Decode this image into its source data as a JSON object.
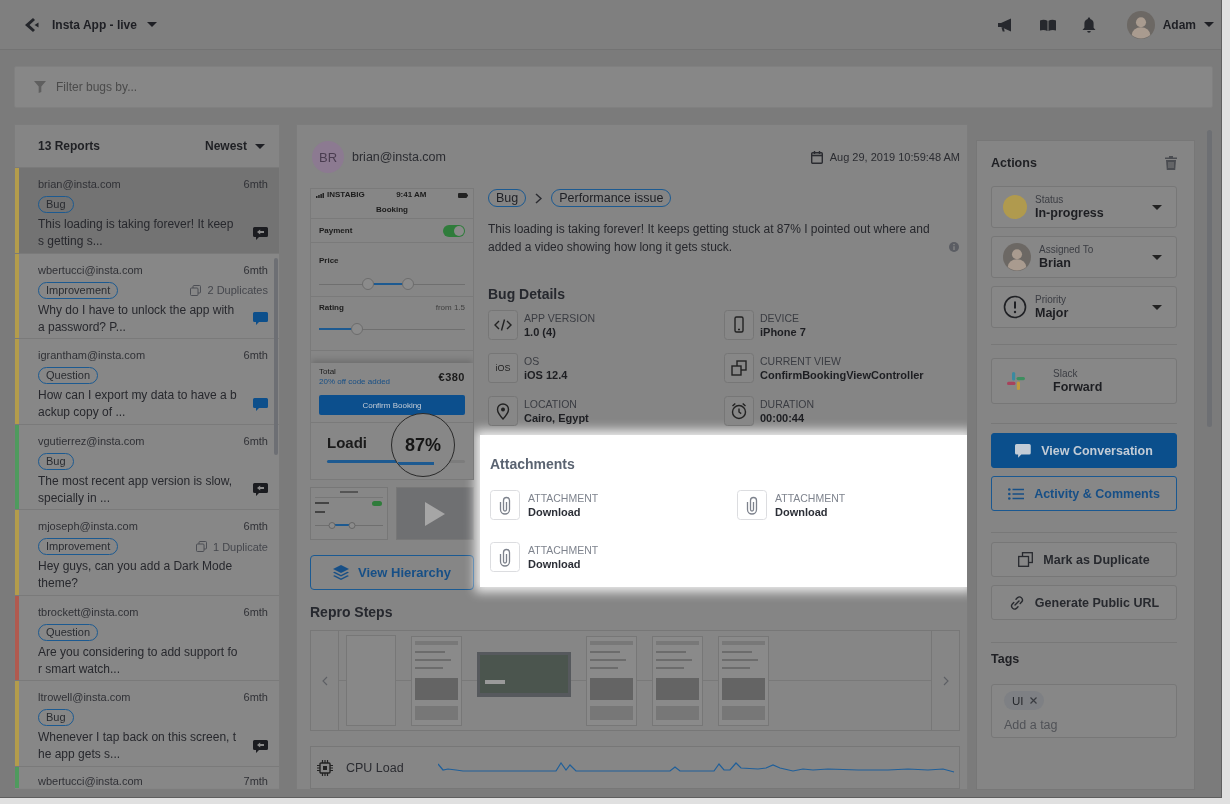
{
  "top_bar": {
    "app_name": "Insta App - live",
    "user_name": "Adam"
  },
  "filter": {
    "placeholder": "Filter bugs by..."
  },
  "reports": {
    "count": "13 Reports",
    "sort": "Newest",
    "items": [
      {
        "email": "brian@insta.com",
        "age": "6mth",
        "tag": "Bug",
        "excerpt": "This loading is taking forever! It keeps getting s...",
        "color": "#b39c4c",
        "selected": true,
        "chat": true,
        "unread": false
      },
      {
        "email": "wbertucci@insta.com",
        "age": "6mth",
        "tag": "Improvement",
        "duplicates": "2 Duplicates",
        "excerpt": "Why do I have to unlock the app with a password? P...",
        "color": "#b39c4c",
        "selected": false,
        "chat": true,
        "unread": true
      },
      {
        "email": "igrantham@insta.com",
        "age": "6mth",
        "tag": "Question",
        "excerpt": "How can I export my data to have a backup copy of ...",
        "color": "#b39c4c",
        "selected": false,
        "chat": true,
        "unread": true
      },
      {
        "email": "vgutierrez@insta.com",
        "age": "6mth",
        "tag": "Bug",
        "excerpt": "The most recent app version is slow, specially in ...",
        "color": "#4f9a5e",
        "selected": false,
        "chat": true,
        "unread": false
      },
      {
        "email": "mjoseph@insta.com",
        "age": "6mth",
        "tag": "Improvement",
        "duplicates": "1 Duplicate",
        "excerpt": "Hey guys, can you add a Dark Mode theme?",
        "color": "#b39c4c",
        "selected": false,
        "chat": false
      },
      {
        "email": "tbrockett@insta.com",
        "age": "6mth",
        "tag": "Question",
        "excerpt": "Are you considering to add support for smart watch...",
        "color": "#b05a4f",
        "selected": false,
        "chat": false
      },
      {
        "email": "ltrowell@insta.com",
        "age": "6mth",
        "tag": "Bug",
        "excerpt": "Whenever I tap back on this screen, the app gets s...",
        "color": "#b39c4c",
        "selected": false,
        "chat": true,
        "unread": false
      },
      {
        "email": "wbertucci@insta.com",
        "age": "7mth",
        "color": "#4f9a5e",
        "selected": false
      }
    ]
  },
  "report": {
    "reporter": {
      "initials": "BR",
      "email": "brian@insta.com"
    },
    "date": "Aug 29, 2019 10:59:48 AM",
    "screenshot": {
      "carrier": "INSTABIG",
      "time": "9:41 AM",
      "title": "Booking",
      "rows": [
        {
          "kind": "toggle",
          "label": "Payment",
          "on": true
        },
        {
          "kind": "range",
          "label": "Price",
          "thumbs": [
            {
              "level": 0.32
            },
            {
              "level": 0.62
            }
          ]
        },
        {
          "kind": "slider",
          "label": "Rating",
          "hint": "from 1.5",
          "level": 0.24
        }
      ],
      "total_label": "Total",
      "discount": "20% off code added",
      "total": "€380",
      "button": "Confirm Booking",
      "loading": "Loadi",
      "level": 0.8,
      "magnified": "87%"
    },
    "media": [
      {
        "kind": "screenshot"
      },
      {
        "kind": "video"
      }
    ],
    "hierarchy_button": "View Hierarchy",
    "breadcrumb": [
      "Bug",
      "Performance issue"
    ],
    "description": "This loading is taking forever! It keeps getting stuck at 87% I pointed out where and added a video showing how long it gets stuck.",
    "details": {
      "title": "Bug Details",
      "items": [
        {
          "kind": "version",
          "label": "APP VERSION",
          "value": "1.0 (4)"
        },
        {
          "kind": "device",
          "label": "DEVICE",
          "value": "iPhone 7"
        },
        {
          "kind": "os",
          "badge": "iOS",
          "label": "OS",
          "value": "iOS 12.4"
        },
        {
          "kind": "view",
          "label": "CURRENT VIEW",
          "value": "ConfirmBookingViewController"
        },
        {
          "kind": "location",
          "label": "LOCATION",
          "value": "Cairo, Egypt"
        },
        {
          "kind": "duration",
          "label": "DURATION",
          "value": "00:00:44"
        }
      ]
    },
    "attachments": {
      "title": "Attachments",
      "items": [
        {
          "label": "ATTACHMENT",
          "action": "Download"
        },
        {
          "label": "ATTACHMENT",
          "action": "Download"
        },
        {
          "label": "ATTACHMENT",
          "action": "Download"
        }
      ]
    },
    "repro": {
      "title": "Repro Steps",
      "steps": [
        {
          "kind": "blank"
        },
        {
          "kind": "portrait"
        },
        {
          "kind": "landscape"
        },
        {
          "kind": "portrait"
        },
        {
          "kind": "portrait"
        },
        {
          "kind": "portrait"
        }
      ]
    },
    "cpu": {
      "label": "CPU Load"
    }
  },
  "actions": {
    "title": "Actions",
    "fields": [
      {
        "kind": "status",
        "label": "Status",
        "value": "In-progress",
        "color": "#b09a4e"
      },
      {
        "kind": "assignee",
        "label": "Assigned To",
        "value": "Brian"
      },
      {
        "kind": "priority",
        "label": "Priority",
        "value": "Major"
      }
    ],
    "integration": {
      "label": "Slack",
      "action": "Forward"
    },
    "buttons": [
      {
        "kind": "primary",
        "label": "View Conversation"
      },
      {
        "kind": "outline",
        "label": "Activity & Comments"
      },
      {
        "kind": "plain",
        "label": "Mark as Duplicate"
      },
      {
        "kind": "plain",
        "label": "Generate Public URL"
      }
    ]
  },
  "tags": {
    "title": "Tags",
    "chips": [
      {
        "label": "UI"
      }
    ],
    "placeholder": "Add a tag"
  }
}
